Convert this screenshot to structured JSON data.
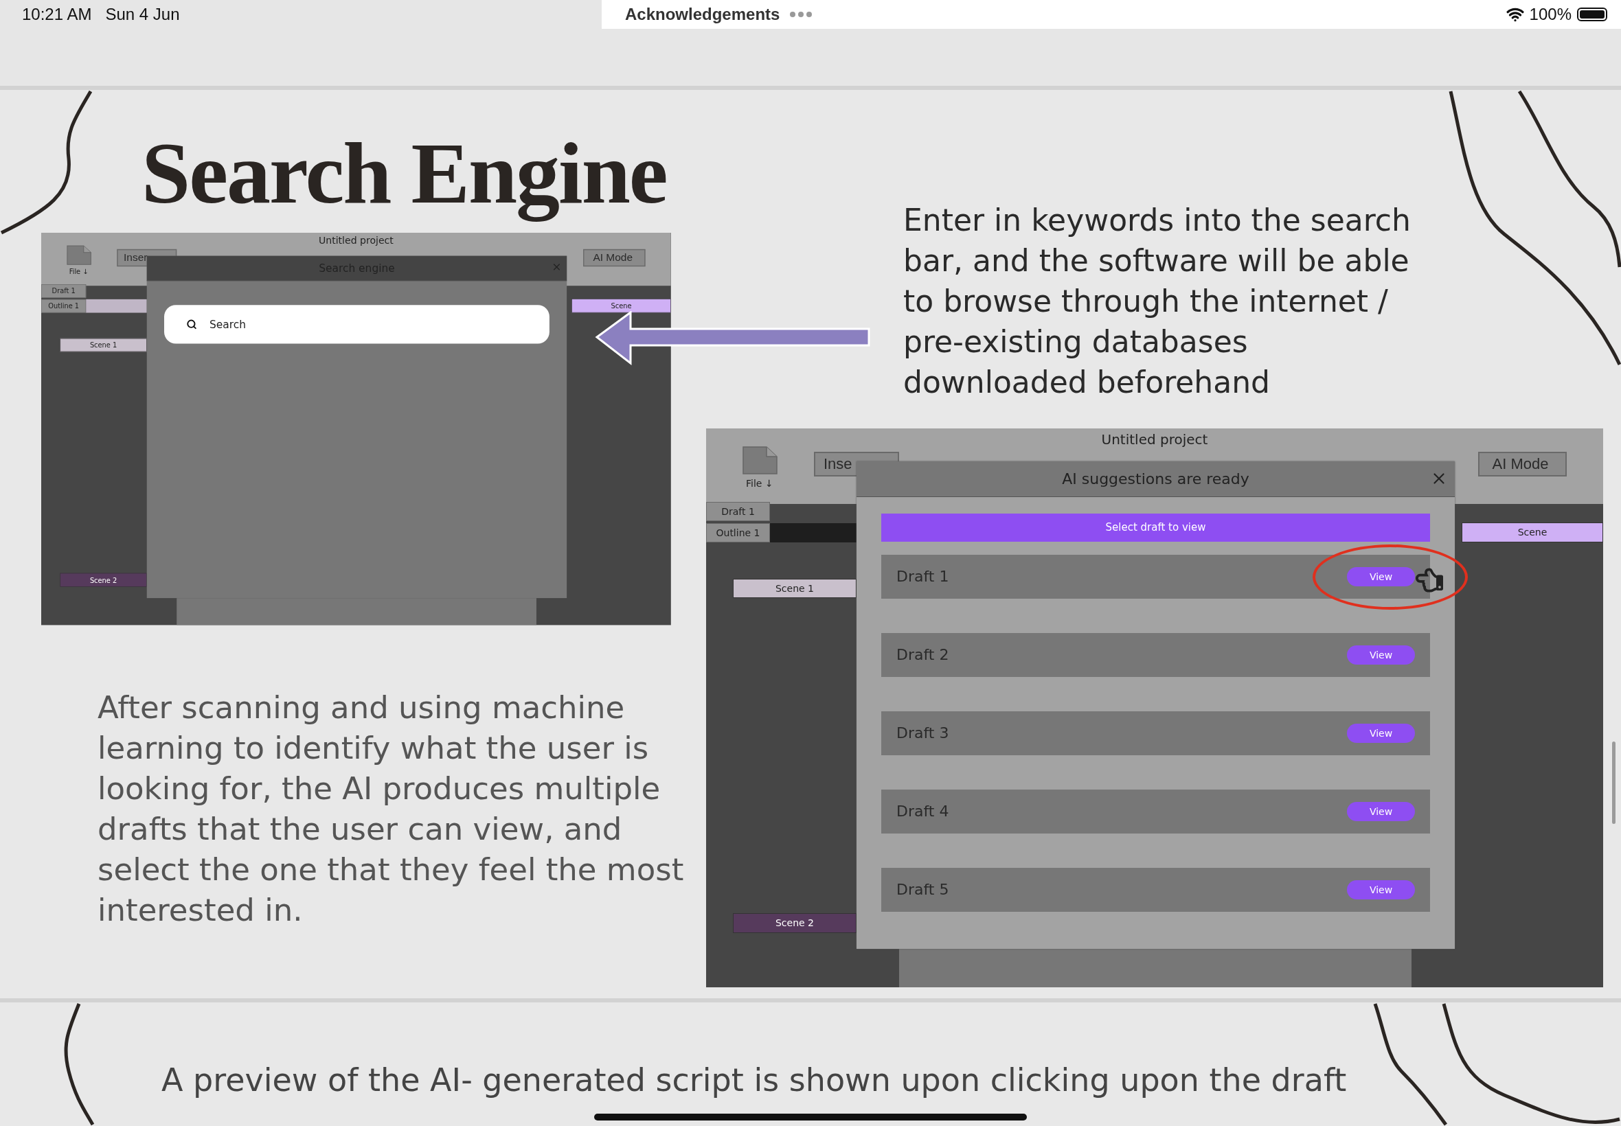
{
  "status_bar": {
    "time": "10:21 AM",
    "date": "Sun 4 Jun",
    "app_title": "Acknowledgements",
    "battery": "100%"
  },
  "slides": [
    {
      "kind": "feature",
      "title": "Search Engine",
      "text_top": "Enter in keywords into the search bar, and the software will be able to browse through the internet / pre-existing databases downloaded beforehand",
      "text_bottom": "After scanning and using machine learning to identify what the user is looking for, the AI produces multiple drafts that the user can view, and select the one that they feel the most interested in.",
      "mockups": [
        {
          "kind": "search",
          "project_title": "Untitled project",
          "file_label": "File ↓",
          "insert_label": "Inser",
          "ai_mode": "AI Mode",
          "tabs": [
            "Draft 1",
            "Outline 1"
          ],
          "scenes": [
            "Scene 1",
            "Scene 2"
          ],
          "scene_right": "Scene",
          "dialog": {
            "title": "Search engine",
            "placeholder": "Search"
          }
        },
        {
          "kind": "drafts",
          "project_title": "Untitled project",
          "file_label": "File ↓",
          "insert_label": "Inse",
          "ai_mode": "AI Mode",
          "tabs": [
            "Draft 1",
            "Outline 1"
          ],
          "scenes": [
            "Scene 1",
            "Scene 2"
          ],
          "scene_right": "Scene",
          "dialog": {
            "title": "AI suggestions are ready",
            "banner": "Select draft to view",
            "drafts": [
              {
                "label": "Draft 1",
                "button": "View",
                "highlighted": true
              },
              {
                "label": "Draft 2",
                "button": "View",
                "highlighted": false
              },
              {
                "label": "Draft 3",
                "button": "View",
                "highlighted": false
              },
              {
                "label": "Draft 4",
                "button": "View",
                "highlighted": false
              },
              {
                "label": "Draft 5",
                "button": "View",
                "highlighted": false
              }
            ]
          }
        }
      ]
    },
    {
      "kind": "caption",
      "text": "A preview of the AI- generated script is shown upon clicking upon the draft"
    }
  ]
}
